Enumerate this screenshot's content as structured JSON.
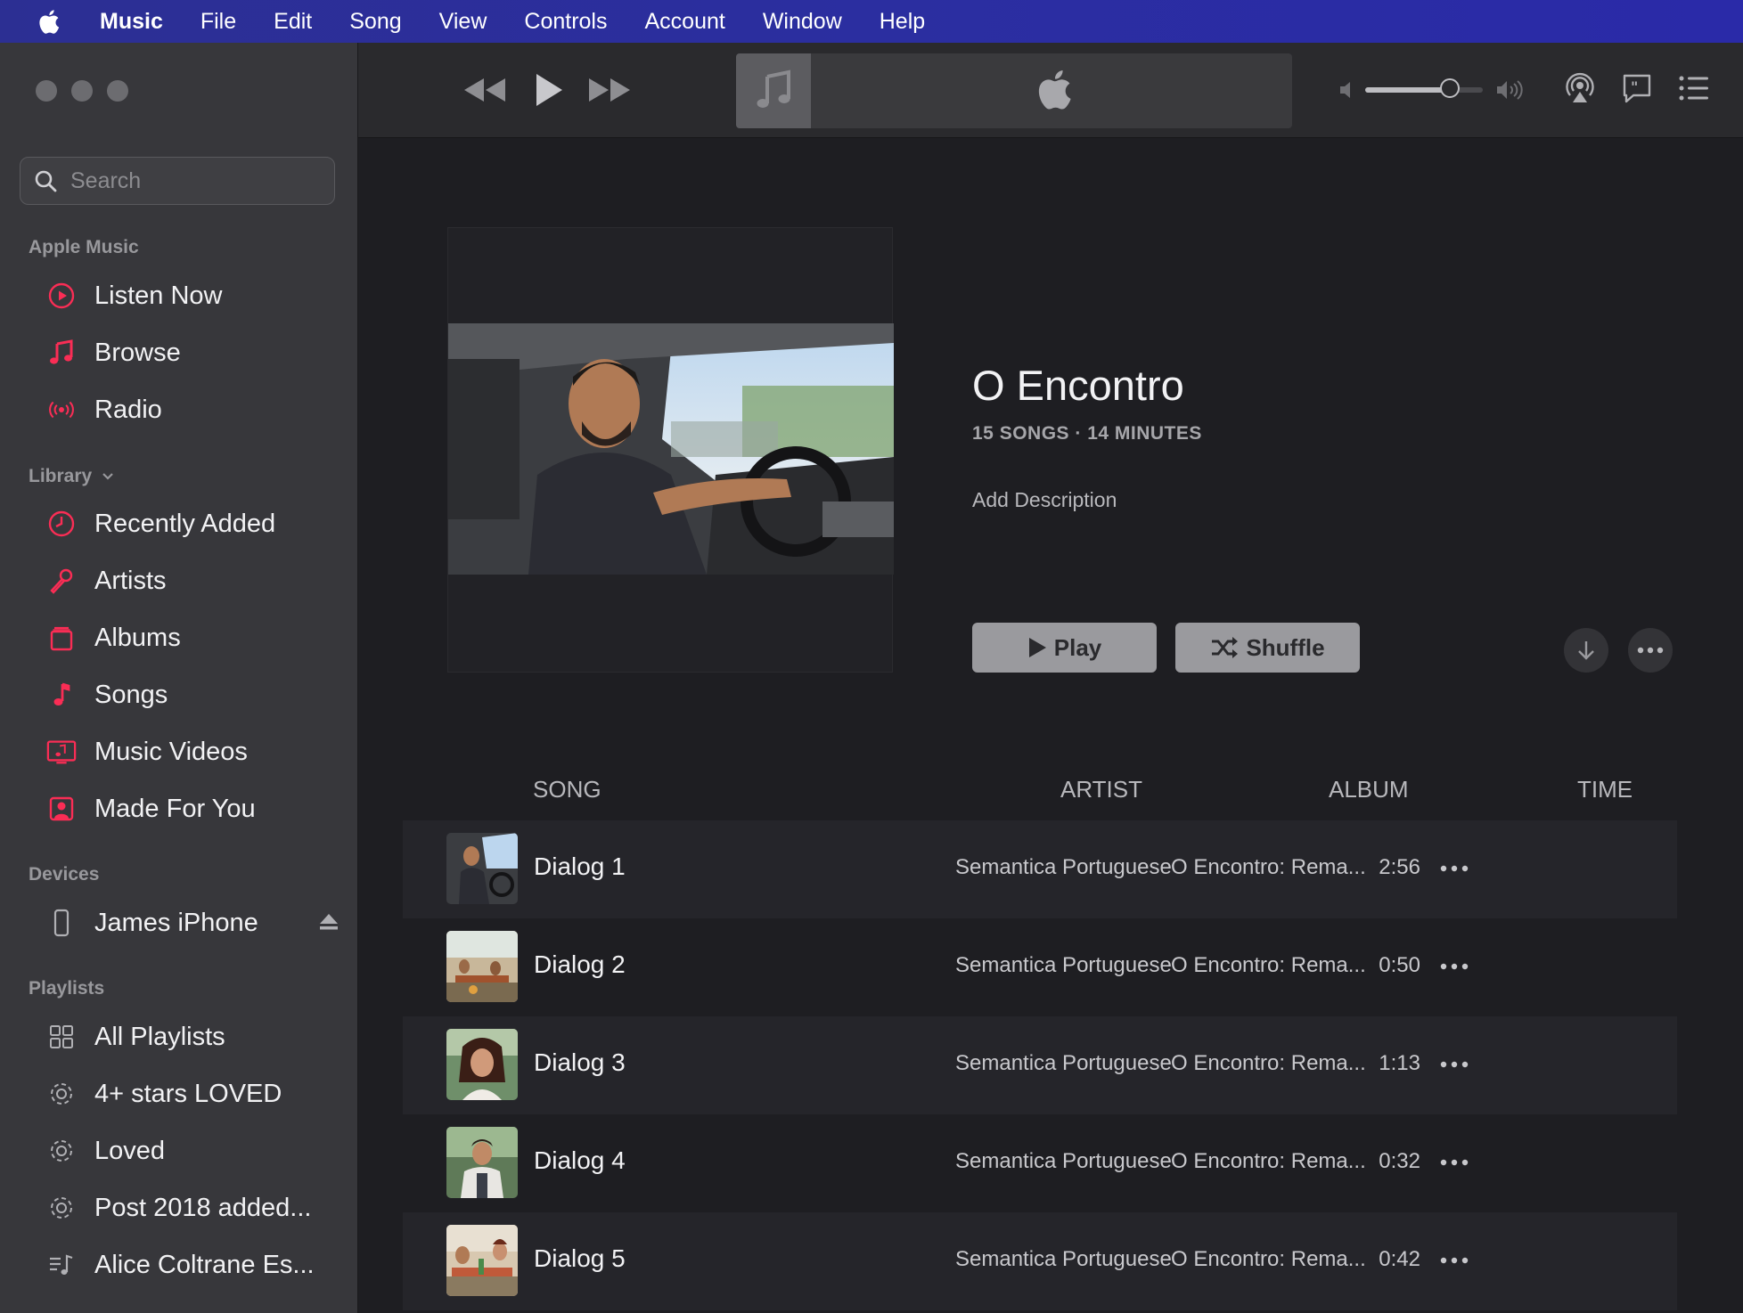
{
  "menubar": {
    "items": [
      "Music",
      "File",
      "Edit",
      "Song",
      "View",
      "Controls",
      "Account",
      "Window",
      "Help"
    ]
  },
  "sidebar": {
    "search": {
      "placeholder": "Search",
      "value": ""
    },
    "sections": [
      {
        "title": "Apple Music",
        "items": [
          {
            "label": "Listen Now",
            "icon": "listen-now-icon"
          },
          {
            "label": "Browse",
            "icon": "music-note-icon"
          },
          {
            "label": "Radio",
            "icon": "radio-icon"
          }
        ]
      },
      {
        "title": "Library",
        "items": [
          {
            "label": "Recently Added",
            "icon": "clock-icon"
          },
          {
            "label": "Artists",
            "icon": "microphone-icon"
          },
          {
            "label": "Albums",
            "icon": "albums-icon"
          },
          {
            "label": "Songs",
            "icon": "song-note-icon"
          },
          {
            "label": "Music Videos",
            "icon": "music-video-icon"
          },
          {
            "label": "Made For You",
            "icon": "person-icon"
          }
        ]
      },
      {
        "title": "Devices",
        "items": [
          {
            "label": "James iPhone",
            "icon": "iphone-icon"
          }
        ]
      },
      {
        "title": "Playlists",
        "items": [
          {
            "label": "All Playlists",
            "icon": "grid-icon"
          },
          {
            "label": "4+ stars LOVED",
            "icon": "smart-playlist-gear-icon"
          },
          {
            "label": "Loved",
            "icon": "smart-playlist-gear-icon"
          },
          {
            "label": "Post 2018 added...",
            "icon": "smart-playlist-gear-icon"
          },
          {
            "label": "Alice Coltrane Es...",
            "icon": "playlist-icon"
          }
        ]
      }
    ]
  },
  "player": {
    "volume_level": 0.72
  },
  "playlist": {
    "title": "O Encontro",
    "meta": "15 SONGS · 14 MINUTES",
    "description": "Add Description",
    "play_label": "Play",
    "shuffle_label": "Shuffle",
    "columns": [
      "SONG",
      "ARTIST",
      "ALBUM",
      "TIME"
    ],
    "tracks": [
      {
        "song": "Dialog 1",
        "artist": "Semantica Portuguese",
        "album": "O Encontro: Rema...",
        "time": "2:56"
      },
      {
        "song": "Dialog 2",
        "artist": "Semantica Portuguese",
        "album": "O Encontro: Rema...",
        "time": "0:50"
      },
      {
        "song": "Dialog 3",
        "artist": "Semantica Portuguese",
        "album": "O Encontro: Rema...",
        "time": "1:13"
      },
      {
        "song": "Dialog 4",
        "artist": "Semantica Portuguese",
        "album": "O Encontro: Rema...",
        "time": "0:32"
      },
      {
        "song": "Dialog 5",
        "artist": "Semantica Portuguese",
        "album": "O Encontro: Rema...",
        "time": "0:42"
      }
    ]
  },
  "colors": {
    "accent": "#fa2d55",
    "menubar": "#2b2ea0",
    "sidebar": "#37373b",
    "main": "#1e1e22"
  }
}
